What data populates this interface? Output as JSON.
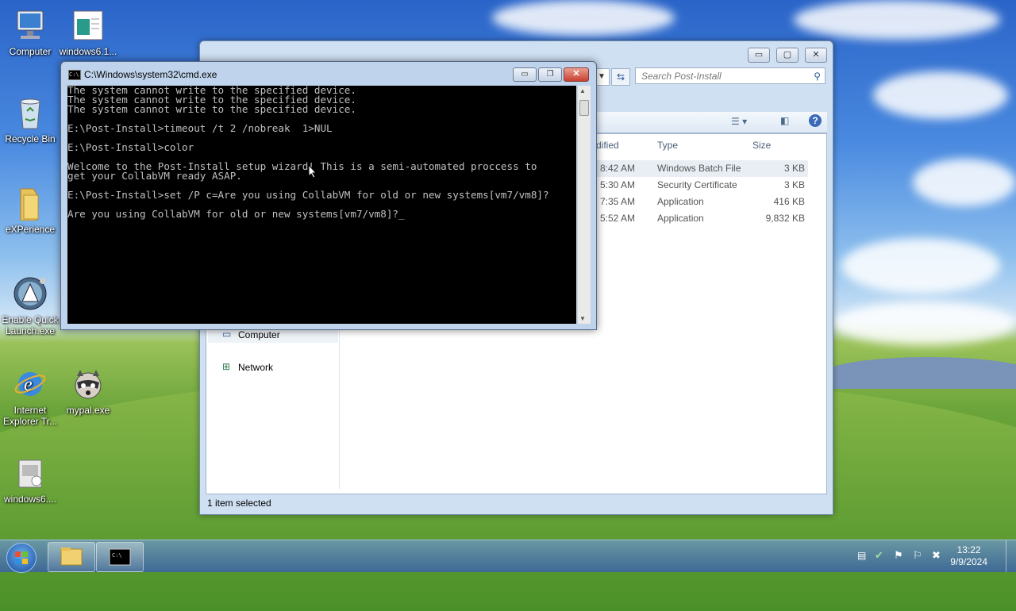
{
  "desktop": {
    "icons": [
      {
        "label": "Computer"
      },
      {
        "label": "windows6.1..."
      },
      {
        "label": "Recycle Bin"
      },
      {
        "label": "eXPerience"
      },
      {
        "label": "Enable Quick Launch.exe"
      },
      {
        "label": "Internet Explorer Tr..."
      },
      {
        "label": "mypal.exe"
      },
      {
        "label": "windows6...."
      }
    ]
  },
  "explorer": {
    "search_placeholder": "Search Post-Install",
    "columns": {
      "modified": "dified",
      "type": "Type",
      "size": "Size"
    },
    "files": [
      {
        "time": "8:42 AM",
        "type": "Windows Batch File",
        "size": "3 KB",
        "selected": true
      },
      {
        "time": "5:30 AM",
        "type": "Security Certificate",
        "size": "3 KB"
      },
      {
        "time": "7:35 AM",
        "type": "Application",
        "size": "416 KB"
      },
      {
        "time": "5:52 AM",
        "type": "Application",
        "size": "9,832 KB"
      }
    ],
    "nav": {
      "computer": "Computer",
      "network": "Network"
    },
    "status": "1 item selected"
  },
  "cmd": {
    "title": "C:\\Windows\\system32\\cmd.exe",
    "lines": [
      "The system cannot write to the specified device.",
      "The system cannot write to the specified device.",
      "The system cannot write to the specified device.",
      "",
      "E:\\Post-Install>timeout /t 2 /nobreak  1>NUL",
      "",
      "E:\\Post-Install>color",
      "",
      "Welcome to the Post-Install setup wizard! This is a semi-automated proccess to",
      "get your CollabVM ready ASAP.",
      "",
      "E:\\Post-Install>set /P c=Are you using CollabVM for old or new systems[vm7/vm8]?",
      "",
      "Are you using CollabVM for old or new systems[vm7/vm8]?_"
    ]
  },
  "taskbar": {
    "time": "13:22",
    "date": "9/9/2024"
  }
}
